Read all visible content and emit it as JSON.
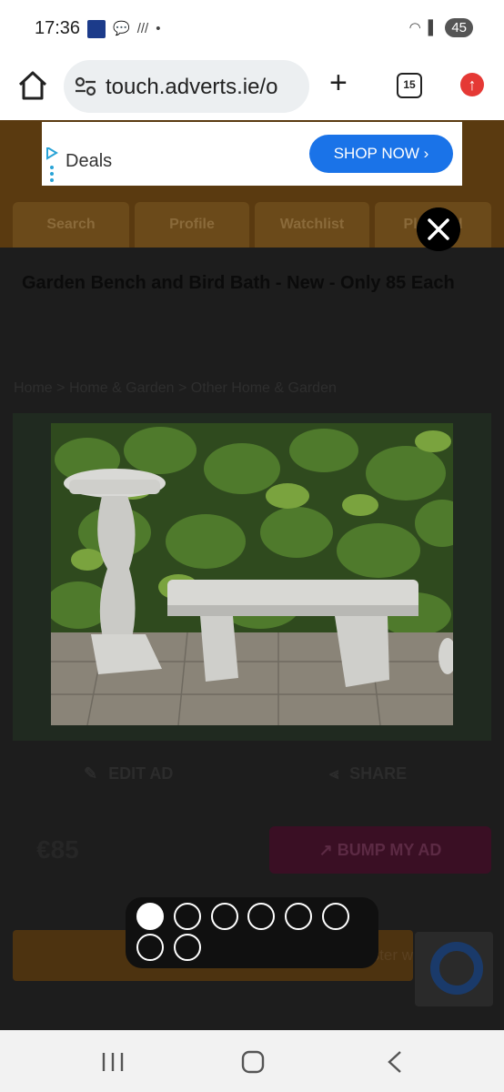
{
  "status": {
    "time": "17:36",
    "battery": "45"
  },
  "browser": {
    "url": "touch.adverts.ie/o",
    "tab_count": "15"
  },
  "site": {
    "nav_tabs": [
      "Search",
      "Profile",
      "Watchlist",
      "Place ad"
    ],
    "ad_title": "Garden Bench and Bird Bath - New - Only 85 Each",
    "breadcrumb": [
      "Home",
      "Home & Garden",
      "Other Home & Garden"
    ],
    "edit_label": "EDIT AD",
    "share_label": "SHARE",
    "price": "€85",
    "bump_label": "BUMP MY AD",
    "bar_text": "Upgrade your ad to sell faster with Win"
  },
  "ad_banner": {
    "text": "Deals",
    "button": "SHOP NOW"
  },
  "gallery": {
    "image_count": 8,
    "current_index": 1
  }
}
